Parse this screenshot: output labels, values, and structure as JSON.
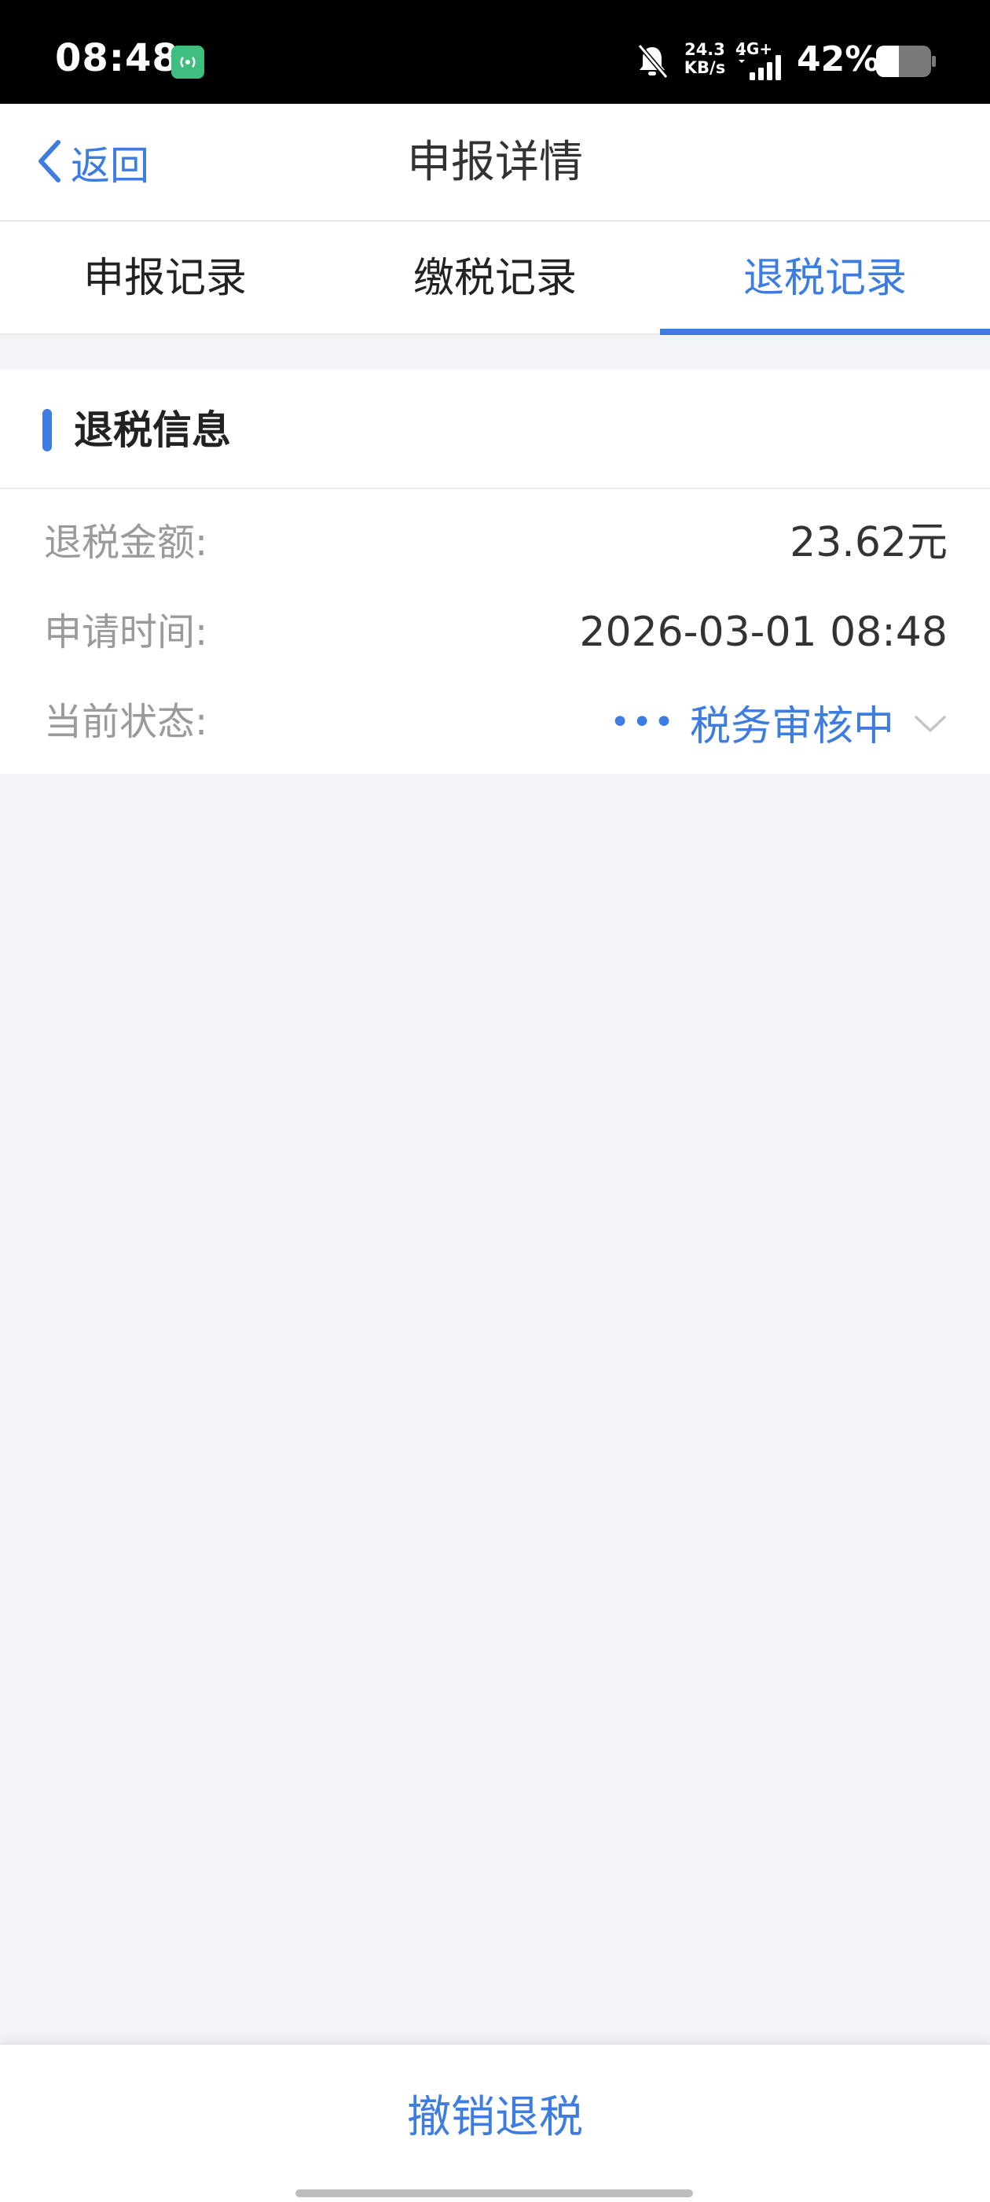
{
  "status_bar": {
    "time": "08:48",
    "net_speed_value": "24.3",
    "net_speed_unit": "KB/s",
    "signal": "4G+",
    "battery": "42%"
  },
  "nav": {
    "back_label": "返回",
    "title": "申报详情"
  },
  "tabs": [
    {
      "label": "申报记录",
      "active": false
    },
    {
      "label": "缴税记录",
      "active": false
    },
    {
      "label": "退税记录",
      "active": true
    }
  ],
  "refund_info": {
    "section_title": "退税信息",
    "rows": [
      {
        "label": "退税金额:",
        "value": "23.62元"
      },
      {
        "label": "申请时间:",
        "value": "2026-03-01 08:48"
      },
      {
        "label": "当前状态:",
        "value": "税务审核中"
      }
    ]
  },
  "bottom": {
    "cancel_label": "撤销退税"
  },
  "colors": {
    "accent": "#3d7ce0",
    "background": "#f3f4f8"
  }
}
